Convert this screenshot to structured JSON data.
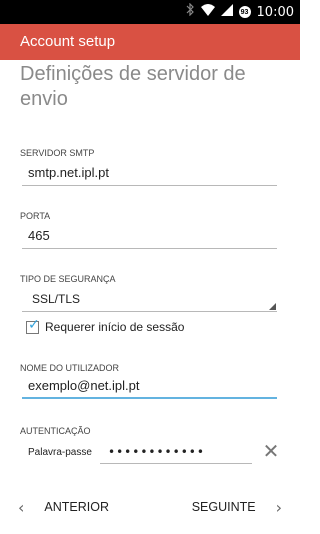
{
  "status_bar": {
    "time": "10:00",
    "battery_level": "93",
    "icons": [
      "bluetooth-icon",
      "wifi-icon",
      "signal-icon",
      "battery-icon"
    ]
  },
  "app_bar": {
    "title": "Account setup",
    "color": "#d95143"
  },
  "page": {
    "title": "Definições de servidor de envio"
  },
  "form": {
    "smtp_server": {
      "label": "SERVIDOR SMTP",
      "value": "smtp.net.ipl.pt"
    },
    "port": {
      "label": "PORTA",
      "value": "465"
    },
    "security_type": {
      "label": "TIPO DE SEGURANÇA",
      "value": "SSL/TLS"
    },
    "require_login": {
      "label": "Requerer início de sessão",
      "checked": true
    },
    "username": {
      "label": "NOME DO UTILIZADOR",
      "value": "exemplo@net.ipl.pt"
    },
    "authentication": {
      "label": "AUTENTICAÇÃO",
      "password_label": "Palavra-passe",
      "password_value": "••••••••••••"
    }
  },
  "nav": {
    "previous_label": "ANTERIOR",
    "next_label": "SEGUINTE"
  },
  "colors": {
    "accent": "#63b3e0",
    "check": "#33a3dc"
  }
}
